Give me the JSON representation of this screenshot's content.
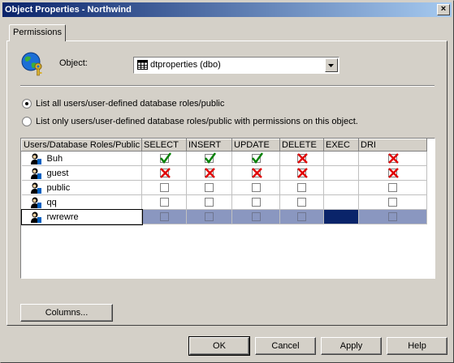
{
  "window": {
    "title": "Object Properties - Northwind"
  },
  "tabs": [
    {
      "label": "Permissions"
    }
  ],
  "object": {
    "label": "Object:",
    "selected": "dtproperties (dbo)"
  },
  "radios": [
    {
      "label": "List all users/user-defined database roles/public",
      "checked": true
    },
    {
      "label": "List only users/user-defined database roles/public with permissions on this object.",
      "checked": false
    }
  ],
  "grid": {
    "columns": [
      "Users/Database Roles/Public",
      "SELECT",
      "INSERT",
      "UPDATE",
      "DELETE",
      "EXEC",
      "DRI"
    ],
    "rows": [
      {
        "name": "Buh",
        "icon": "user-icon",
        "perms": [
          "grant",
          "grant",
          "grant",
          "deny",
          "none",
          "deny"
        ]
      },
      {
        "name": "guest",
        "icon": "user-icon",
        "perms": [
          "deny",
          "deny",
          "deny",
          "deny",
          "none",
          "deny"
        ]
      },
      {
        "name": "public",
        "icon": "user-icon",
        "perms": [
          "empty",
          "empty",
          "empty",
          "empty",
          "none",
          "empty"
        ]
      },
      {
        "name": "qq",
        "icon": "user-icon",
        "perms": [
          "empty",
          "empty",
          "empty",
          "empty",
          "none",
          "empty"
        ]
      },
      {
        "name": "rwrewre",
        "icon": "user-icon",
        "perms": [
          "empty",
          "empty",
          "empty",
          "empty",
          "none",
          "empty"
        ],
        "selected": true
      }
    ]
  },
  "buttons": {
    "columns": "Columns...",
    "ok": "OK",
    "cancel": "Cancel",
    "apply": "Apply",
    "help": "Help"
  },
  "colors": {
    "grant": "#008000",
    "deny": "#e00000",
    "selection": "#8a97c0",
    "exec_selected": "#0a246a"
  }
}
